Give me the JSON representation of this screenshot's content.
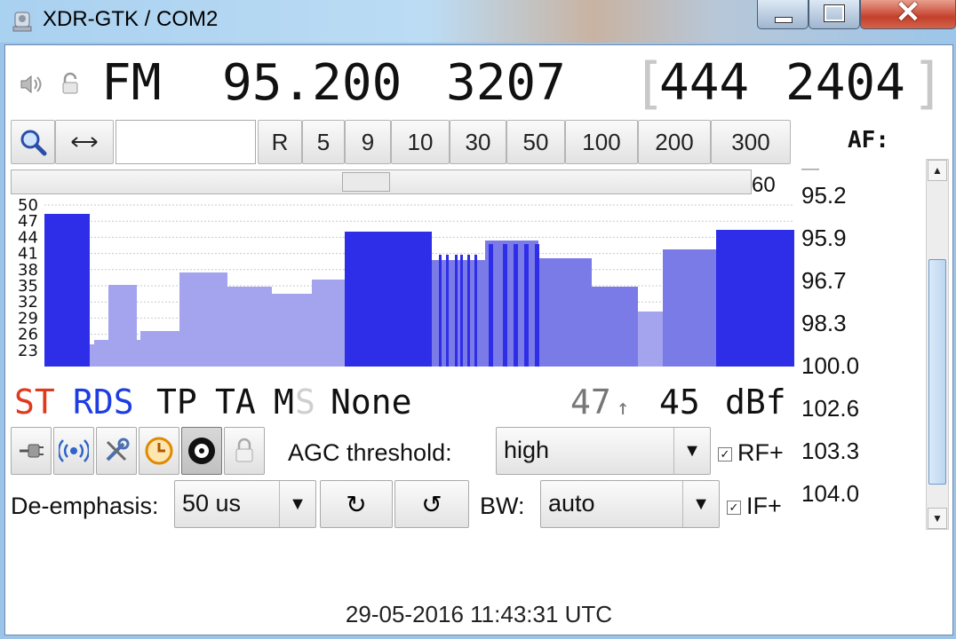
{
  "window": {
    "title": "XDR-GTK / COM2",
    "close_glyph": "✕"
  },
  "tuner": {
    "mode": "FM",
    "frequency": "95.200",
    "pi": "3207",
    "bracket_open": "[",
    "bracket_close": "]",
    "extra_value_1": "444",
    "extra_value_2": "2404"
  },
  "step_buttons": [
    "R",
    "5",
    "9",
    "10",
    "30",
    "50",
    "100",
    "200",
    "300"
  ],
  "freq_entry": {
    "value": ""
  },
  "af": {
    "label": "AF:",
    "items": [
      "95.2",
      "95.9",
      "96.7",
      "98.3",
      "100.0",
      "102.6",
      "103.3",
      "104.0"
    ]
  },
  "scan_slider": {
    "value": "60"
  },
  "graph": {
    "y_ticks": [
      "50",
      "47",
      "44",
      "41",
      "38",
      "35",
      "32",
      "29",
      "26",
      "23"
    ],
    "colors": {
      "light": "#a3a3ee",
      "medium": "#7b7be8",
      "dark": "#2e2ee8"
    }
  },
  "status": {
    "st": "ST",
    "rds": "RDS",
    "tp": "TP",
    "ta": "TA",
    "m": "M",
    "s": "S",
    "pty": "None",
    "max_signal": "47",
    "arrow": "↑",
    "signal": "45",
    "unit": "dBf",
    "colors": {
      "st": "#e03a1e",
      "rds": "#1e3de0",
      "inactive": "#c8c8c8"
    }
  },
  "controls": {
    "agc_label": "AGC threshold:",
    "agc_value": "high",
    "rf_plus": "RF+",
    "rf_plus_checked": true,
    "deemphasis_label": "De-emphasis:",
    "deemphasis_value": "50 us",
    "rotate_left_glyph": "↻",
    "rotate_right_glyph": "↺",
    "bw_label": "BW:",
    "bw_value": "auto",
    "if_plus": "IF+",
    "if_plus_checked": true
  },
  "icons": [
    "speaker-icon",
    "lock-icon",
    "search-icon",
    "swap-arrows-icon",
    "plug-icon",
    "antenna-icon",
    "tools-icon",
    "clock-icon",
    "record-icon",
    "padlock-icon"
  ],
  "footer": {
    "datetime": "29-05-2016 11:43:31 UTC"
  }
}
